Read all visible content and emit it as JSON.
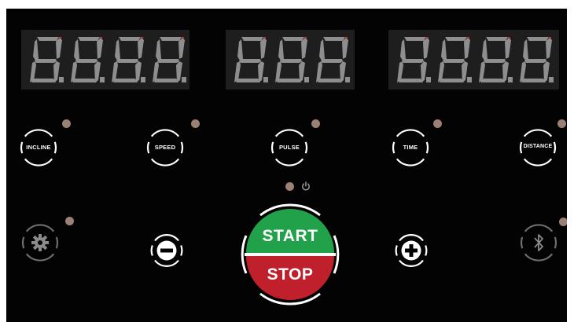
{
  "displays": [
    {
      "name": "display-left",
      "digits": 4,
      "value": "8.8.8.8."
    },
    {
      "name": "display-center",
      "digits": 3,
      "value": "8.8.8."
    },
    {
      "name": "display-right",
      "digits": 4,
      "value": "8.8.8.8."
    }
  ],
  "mode_buttons": [
    {
      "name": "incline-button",
      "label": "INCLINE"
    },
    {
      "name": "speed-button",
      "label": "SPEED"
    },
    {
      "name": "pulse-button",
      "label": "PULSE"
    },
    {
      "name": "time-button",
      "label": "TIME"
    },
    {
      "name": "distance-button",
      "label": "DISTANCE"
    }
  ],
  "controls": {
    "settings_icon": "gear-icon",
    "minus_icon": "minus-icon",
    "plus_icon": "plus-icon",
    "bluetooth_icon": "bluetooth-icon",
    "power_icon": "power-icon"
  },
  "start_stop": {
    "start_label": "START",
    "stop_label": "STOP"
  },
  "colors": {
    "panel": "#030303",
    "display_bg": "#1e1e1e",
    "segment": "#8e8e8e",
    "led": "#9b8076",
    "start_green": "#21a24a",
    "stop_red": "#c0202c"
  }
}
